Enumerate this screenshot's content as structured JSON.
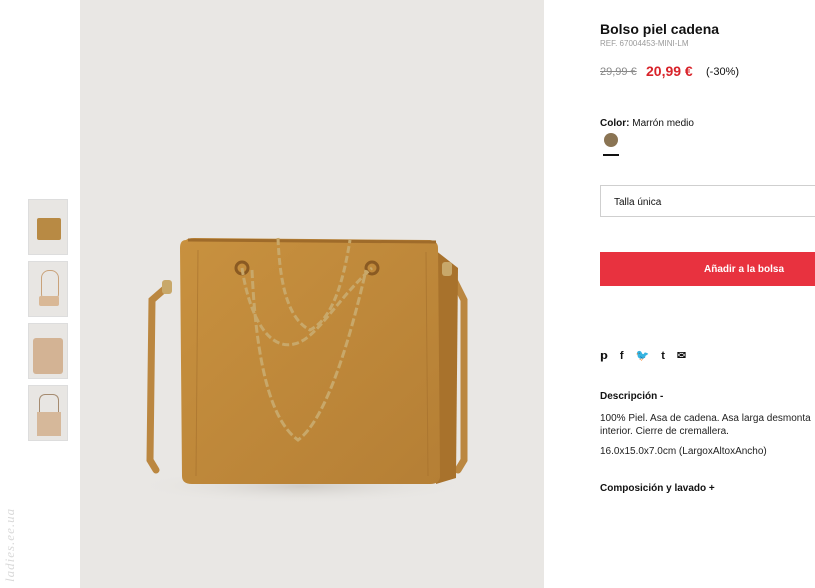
{
  "product": {
    "title": "Bolso piel cadena",
    "ref": "REF. 67004453-MINI-LM",
    "price_old": "29,99 €",
    "price_new": "20,99 €",
    "discount": "(-30%)"
  },
  "color": {
    "label": "Color:",
    "value": "Marrón medio",
    "swatch": "#8a7453"
  },
  "size": {
    "value": "Talla única"
  },
  "actions": {
    "add_to_bag": "Añadir a la bolsa"
  },
  "share_icons": [
    "pinterest-icon",
    "facebook-icon",
    "twitter-icon",
    "tumblr-icon",
    "email-icon"
  ],
  "description": {
    "heading": "Descripción -",
    "text": "100% Piel. Asa de cadena. Asa larga desmonta interior. Cierre de cremallera.",
    "dimensions": "16.0x15.0x7.0cm (LargoxAltoxAncho)"
  },
  "composition": {
    "heading": "Composición y lavado +"
  },
  "watermark": "ladies.ee.ua",
  "colors": {
    "accent": "#e8323f",
    "sale": "#d8232a",
    "bag": "#c08a3e"
  }
}
